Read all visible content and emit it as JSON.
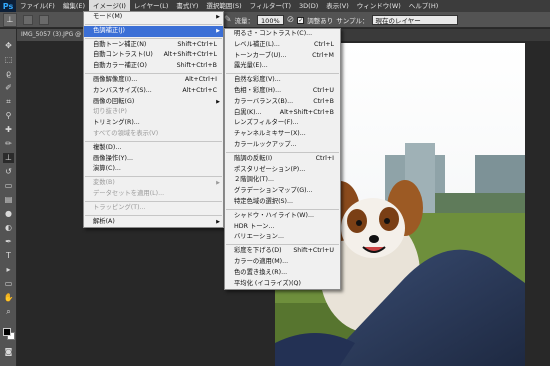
{
  "app": {
    "logo": "Ps"
  },
  "menubar": [
    "ファイル(F)",
    "編集(E)",
    "イメージ(I)",
    "レイヤー(L)",
    "書式(Y)",
    "選択範囲(S)",
    "フィルター(T)",
    "3D(D)",
    "表示(V)",
    "ウィンドウ(W)",
    "ヘルプ(H)"
  ],
  "optbar": {
    "flow_label": "流量：",
    "flow_value": "100%",
    "align_label": "調整あり",
    "sample_label": "サンプル：",
    "sample_value": "現在のレイヤー"
  },
  "document": {
    "tab_title": "IMG_5057 (3).JPG @ 66.7%"
  },
  "image_menu": [
    {
      "label": "モード(M)",
      "arrow": true
    },
    {
      "sep": true
    },
    {
      "label": "色調補正(J)",
      "arrow": true,
      "highlighted": true
    },
    {
      "sep": true
    },
    {
      "label": "自動トーン補正(N)",
      "shortcut": "Shift+Ctrl+L"
    },
    {
      "label": "自動コントラスト(U)",
      "shortcut": "Alt+Shift+Ctrl+L"
    },
    {
      "label": "自動カラー補正(O)",
      "shortcut": "Shift+Ctrl+B"
    },
    {
      "sep": true
    },
    {
      "label": "画像解像度(I)...",
      "shortcut": "Alt+Ctrl+I"
    },
    {
      "label": "カンバスサイズ(S)...",
      "shortcut": "Alt+Ctrl+C"
    },
    {
      "label": "画像の回転(G)",
      "arrow": true
    },
    {
      "label": "切り抜き(P)",
      "disabled": true
    },
    {
      "label": "トリミング(R)..."
    },
    {
      "label": "すべての領域を表示(V)",
      "disabled": true
    },
    {
      "sep": true
    },
    {
      "label": "複製(D)..."
    },
    {
      "label": "画像操作(Y)..."
    },
    {
      "label": "演算(C)..."
    },
    {
      "sep": true
    },
    {
      "label": "変数(B)",
      "arrow": true,
      "disabled": true
    },
    {
      "label": "データセットを適用(L)...",
      "disabled": true
    },
    {
      "sep": true
    },
    {
      "label": "トラッピング(T)...",
      "disabled": true
    },
    {
      "sep": true
    },
    {
      "label": "解析(A)",
      "arrow": true
    }
  ],
  "adjust_menu": [
    {
      "label": "明るさ・コントラスト(C)..."
    },
    {
      "label": "レベル補正(L)...",
      "shortcut": "Ctrl+L"
    },
    {
      "label": "トーンカーブ(U)...",
      "shortcut": "Ctrl+M"
    },
    {
      "label": "露光量(E)..."
    },
    {
      "sep": true
    },
    {
      "label": "自然な彩度(V)..."
    },
    {
      "label": "色相・彩度(H)...",
      "shortcut": "Ctrl+U"
    },
    {
      "label": "カラーバランス(B)...",
      "shortcut": "Ctrl+B"
    },
    {
      "label": "白黒(K)...",
      "shortcut": "Alt+Shift+Ctrl+B"
    },
    {
      "label": "レンズフィルター(F)..."
    },
    {
      "label": "チャンネルミキサー(X)..."
    },
    {
      "label": "カラールックアップ..."
    },
    {
      "sep": true
    },
    {
      "label": "階調の反転(I)",
      "shortcut": "Ctrl+I"
    },
    {
      "label": "ポスタリゼーション(P)..."
    },
    {
      "label": "２階調化(T)..."
    },
    {
      "label": "グラデーションマップ(G)..."
    },
    {
      "label": "特定色域の選択(S)..."
    },
    {
      "sep": true
    },
    {
      "label": "シャドウ・ハイライト(W)..."
    },
    {
      "label": "HDR トーン..."
    },
    {
      "label": "バリエーション..."
    },
    {
      "sep": true
    },
    {
      "label": "彩度を下げる(D)",
      "shortcut": "Shift+Ctrl+U"
    },
    {
      "label": "カラーの適用(M)..."
    },
    {
      "label": "色の置き換え(R)..."
    },
    {
      "label": "平均化 (イコライズ)(Q)"
    }
  ]
}
